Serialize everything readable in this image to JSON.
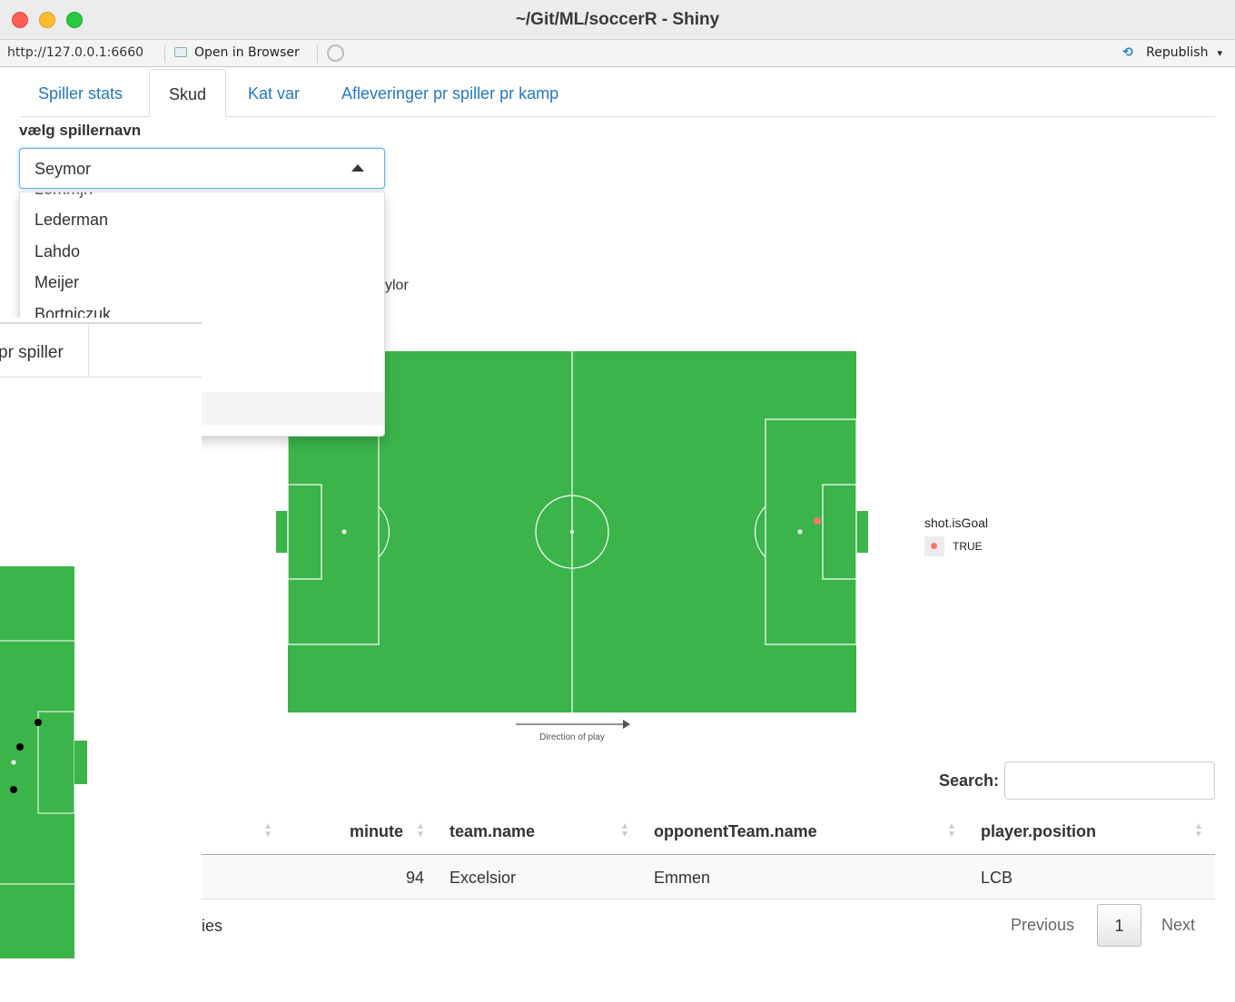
{
  "window": {
    "title": "~/Git/ML/soccerR - Shiny"
  },
  "addressbar": {
    "url": "http://127.0.0.1:6660",
    "open_in_browser": "Open in Browser",
    "republish": "Republish"
  },
  "tabs": [
    {
      "label": "Spiller stats",
      "active": false
    },
    {
      "label": "Skud",
      "active": true
    },
    {
      "label": "Kat var",
      "active": false
    },
    {
      "label": "Afleveringer pr spiller pr kamp",
      "active": false
    }
  ],
  "player_select": {
    "label": "vælg spillernavn",
    "value": "Seymor",
    "options_visible": [
      "Lederman",
      "Lahdo",
      "Meijer",
      "Bortniczuk"
    ]
  },
  "partial_label": "ylor",
  "overlay": {
    "tab_partial": "pr spiller"
  },
  "pitch": {
    "direction_label": "Direction of play",
    "colors": {
      "grass": "#3bb44a",
      "lines": "#ffffff",
      "goal_point": "#f8766d"
    }
  },
  "legend": {
    "title": "shot.isGoal",
    "label": "TRUE"
  },
  "table": {
    "search_label": "Search:",
    "columns": [
      "minute",
      "team.name",
      "opponentTeam.name",
      "player.position"
    ],
    "rows": [
      {
        "minute": "94",
        "team": "Excelsior",
        "opponent": "Emmen",
        "position": "LCB"
      }
    ],
    "info_partial": "ies",
    "pagination": {
      "previous": "Previous",
      "current": "1",
      "next": "Next"
    }
  }
}
